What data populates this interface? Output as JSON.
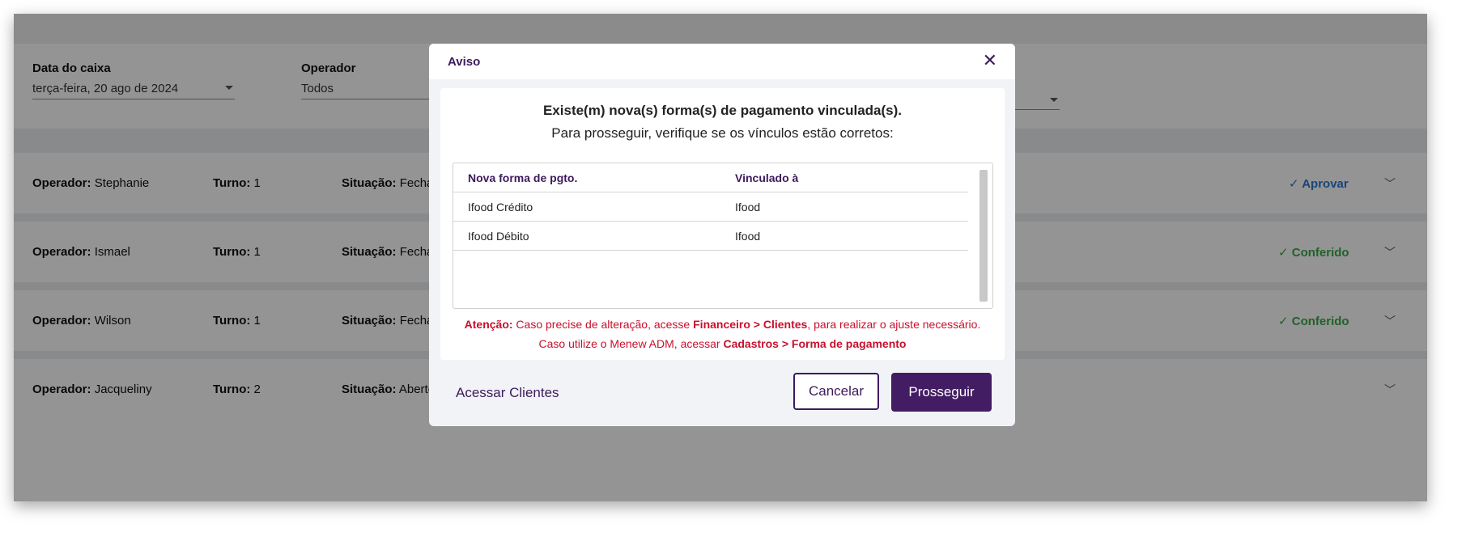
{
  "filters": {
    "date_label": "Data do caixa",
    "date_value": "terça-feira, 20 ago de 2024",
    "operator_label": "Operador",
    "operator_value": "Todos"
  },
  "rows": [
    {
      "operator_label": "Operador:",
      "operator": "Stephanie",
      "turn_label": "Turno:",
      "turn": "1",
      "status_label": "Situação:",
      "status_partial": "Fecha",
      "action": "Aprovar"
    },
    {
      "operator_label": "Operador:",
      "operator": "Ismael",
      "turn_label": "Turno:",
      "turn": "1",
      "status_label": "Situação:",
      "status_partial": "Fecha",
      "action": "Conferido"
    },
    {
      "operator_label": "Operador:",
      "operator": "Wilson",
      "turn_label": "Turno:",
      "turn": "1",
      "status_label": "Situação:",
      "status_partial": "Fecha",
      "action": "Conferido"
    },
    {
      "operator_label": "Operador:",
      "operator": "Jacqueliny",
      "turn_label": "Turno:",
      "turn": "2",
      "status_label": "Situação:",
      "status_partial": "Aberto",
      "action": ""
    }
  ],
  "modal": {
    "title": "Aviso",
    "close_glyph": "✕",
    "heading": "Existe(m) nova(s) forma(s) de pagamento vinculada(s).",
    "subheading": "Para prosseguir, verifique se os vínculos estão corretos:",
    "table": {
      "col_new": "Nova forma de pgto.",
      "col_linked": "Vinculado à",
      "rows": [
        {
          "new": "Ifood Crédito",
          "linked": "Ifood"
        },
        {
          "new": "Ifood Débito",
          "linked": "Ifood"
        }
      ]
    },
    "warning": {
      "label": "Atenção:",
      "text1": " Caso precise de alteração, acesse ",
      "path1": "Financeiro > Clientes",
      "text2": ", para realizar o ajuste necessário.",
      "text3": "Caso utilize o Menew ADM, acessar ",
      "path2": "Cadastros > Forma de pagamento"
    },
    "link_label": "Acessar Clientes",
    "cancel_label": "Cancelar",
    "proceed_label": "Prosseguir"
  },
  "icons": {
    "check": "✓",
    "chevron": "﹀"
  },
  "colors": {
    "brand": "#431d63",
    "approve": "#2c78d4",
    "checked": "#3aa847",
    "warning": "#c8102e"
  }
}
